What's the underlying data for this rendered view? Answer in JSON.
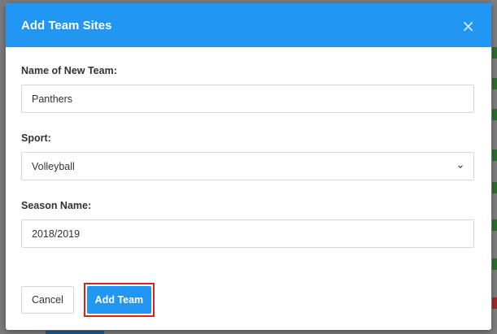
{
  "modal": {
    "title": "Add Team Sites",
    "close_icon": "close-icon",
    "fields": {
      "team_name": {
        "label": "Name of New Team:",
        "value": "Panthers"
      },
      "sport": {
        "label": "Sport:",
        "value": "Volleyball",
        "icon": "chevron-down-icon"
      },
      "season_name": {
        "label": "Season Name:",
        "value": "2018/2019"
      }
    },
    "footer": {
      "cancel_label": "Cancel",
      "add_label": "Add Team"
    }
  },
  "colors": {
    "header": "#2196f3",
    "primary_button": "#2196f3",
    "highlight": "#e0201a"
  }
}
